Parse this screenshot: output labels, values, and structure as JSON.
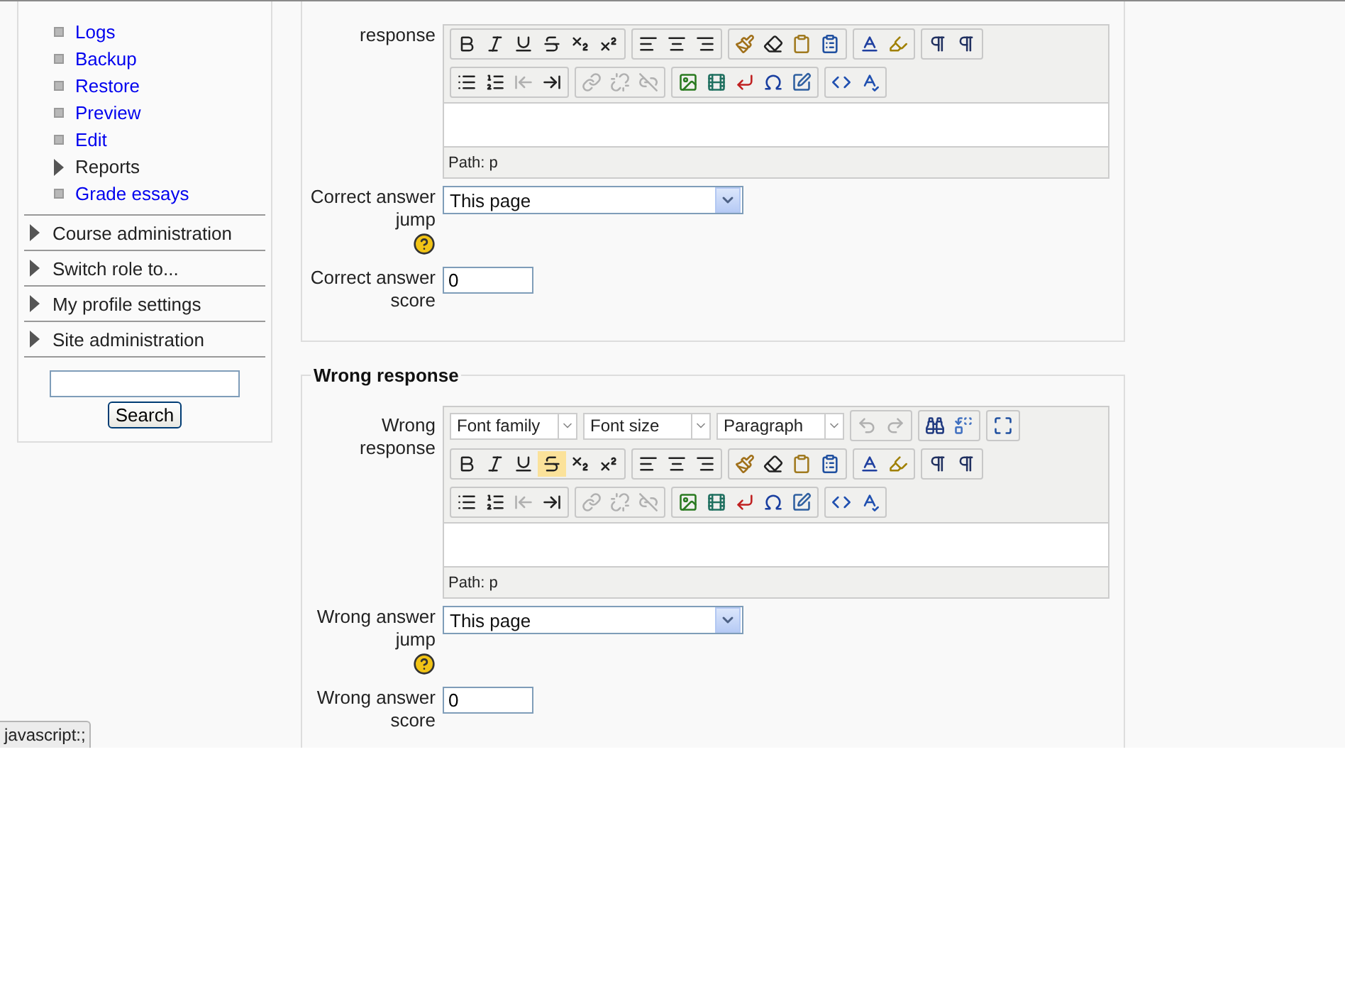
{
  "sidebar": {
    "links": [
      {
        "kind": "link",
        "label": "Logs"
      },
      {
        "kind": "link",
        "label": "Backup"
      },
      {
        "kind": "link",
        "label": "Restore"
      },
      {
        "kind": "link",
        "label": "Preview"
      },
      {
        "kind": "link",
        "label": "Edit"
      },
      {
        "kind": "branch",
        "label": "Reports",
        "expanded": false
      },
      {
        "kind": "link",
        "label": "Grade essays"
      }
    ],
    "sections": [
      {
        "label": "Course administration",
        "expanded": false
      },
      {
        "label": "Switch role to...",
        "expanded": false
      },
      {
        "label": "My profile settings",
        "expanded": false
      },
      {
        "label": "Site administration",
        "expanded": false
      }
    ],
    "search_button": "Search"
  },
  "sections": [
    {
      "fields": [
        {
          "kind": "editor",
          "label": "response",
          "path": "Path: p",
          "strike_highlighted": false
        },
        {
          "kind": "select",
          "label": "Correct answer jump",
          "value": "This page",
          "help": true
        },
        {
          "kind": "text",
          "label": "Correct answer score",
          "value": "0"
        }
      ]
    },
    {
      "legend": "Wrong response",
      "fields": [
        {
          "kind": "editor",
          "label": "Wrong response",
          "selects": [
            "Font family",
            "Font size",
            "Paragraph"
          ],
          "path": "Path: p",
          "strike_highlighted": true
        },
        {
          "kind": "select",
          "label": "Wrong answer jump",
          "value": "This page",
          "help": true
        },
        {
          "kind": "text",
          "label": "Wrong answer score",
          "value": "0"
        }
      ]
    }
  ],
  "status_tooltip": "javascript:;"
}
